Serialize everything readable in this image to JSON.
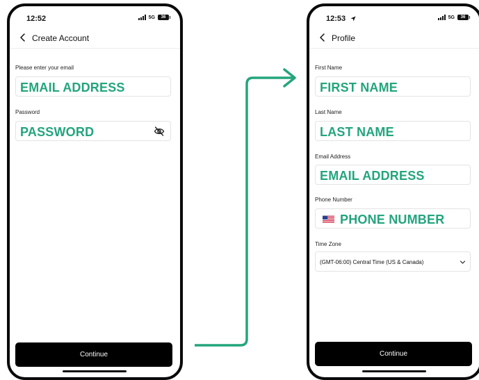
{
  "colors": {
    "placeholder_green": "#23a57c",
    "button_bg": "#000000",
    "arrow_green": "#23a57c"
  },
  "left_screen": {
    "status": {
      "time": "12:52",
      "network": "5G",
      "battery": "36"
    },
    "title": "Create Account",
    "email": {
      "label": "Please enter your email",
      "placeholder": "EMAIL ADDRESS"
    },
    "password": {
      "label": "Password",
      "placeholder": "PASSWORD",
      "icon": "eye-slash-icon"
    },
    "continue_label": "Continue"
  },
  "right_screen": {
    "status": {
      "time": "12:53",
      "network": "5G",
      "battery": "36"
    },
    "title": "Profile",
    "first_name": {
      "label": "First Name",
      "placeholder": "FIRST NAME"
    },
    "last_name": {
      "label": "Last Name",
      "placeholder": "LAST NAME"
    },
    "email": {
      "label": "Email Address",
      "placeholder": "EMAIL ADDRESS"
    },
    "phone": {
      "label": "Phone Number",
      "placeholder": "PHONE NUMBER",
      "icon": "us-flag-icon"
    },
    "time_zone": {
      "label": "Time Zone",
      "value": "(GMT-06:00) Central Time (US & Canada)"
    },
    "continue_label": "Continue"
  }
}
